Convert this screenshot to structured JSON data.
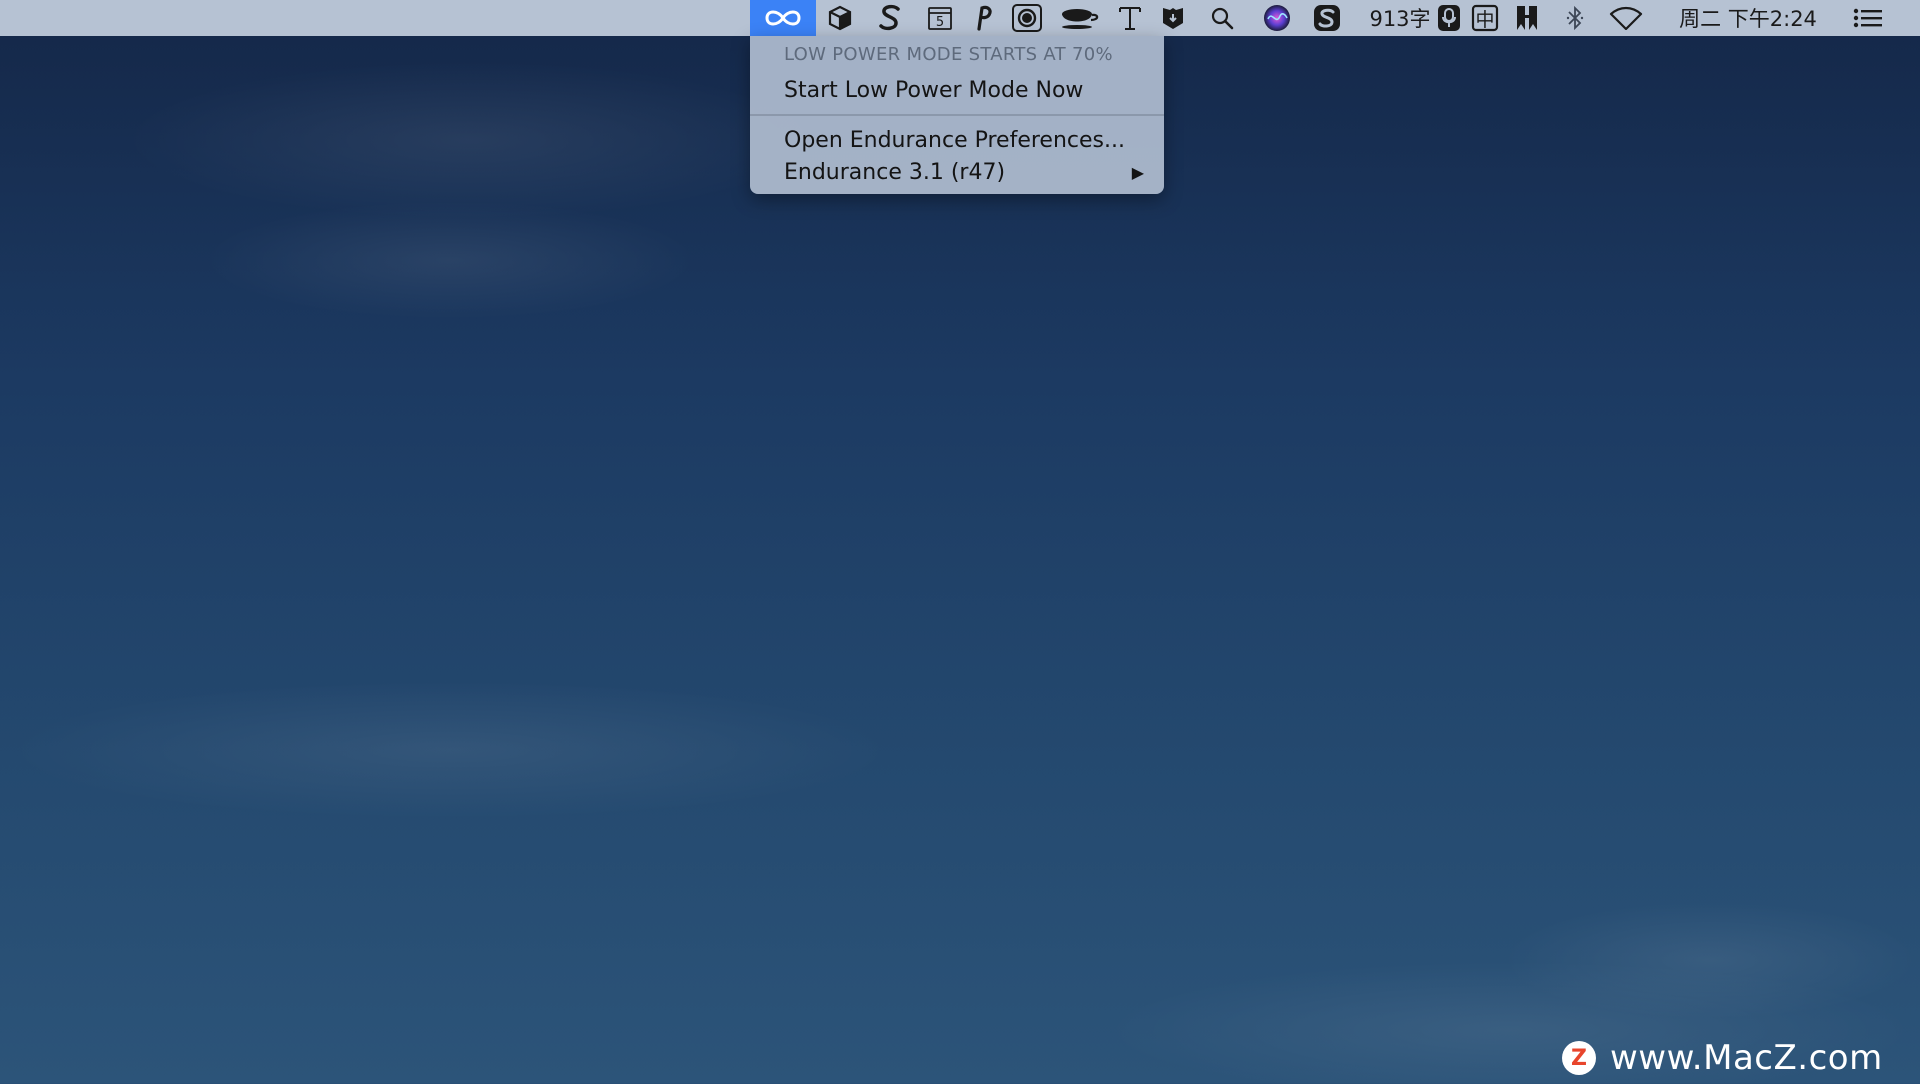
{
  "menubar": {
    "status_items": [
      {
        "name": "endurance-infinity-icon",
        "active": true
      },
      {
        "name": "cube-icon"
      },
      {
        "name": "s-script-icon"
      },
      {
        "name": "calendar-5-icon",
        "text": "5"
      },
      {
        "name": "p-icon"
      },
      {
        "name": "screenshot-icon"
      },
      {
        "name": "coffee-cup-icon"
      },
      {
        "name": "text-t-icon"
      },
      {
        "name": "shield-icon"
      },
      {
        "name": "search-icon"
      },
      {
        "name": "siri-icon"
      },
      {
        "name": "sogou-icon"
      },
      {
        "name": "microphone-icon"
      },
      {
        "name": "input-method-icon",
        "text": "中"
      },
      {
        "name": "bookmark-icon"
      },
      {
        "name": "bluetooth-icon"
      },
      {
        "name": "wifi-icon"
      },
      {
        "name": "notification-center-icon"
      }
    ],
    "word_count": "913字",
    "clock": "周二 下午2:24"
  },
  "menu": {
    "header": "LOW POWER MODE STARTS AT 70%",
    "items": [
      {
        "label": "Start Low Power Mode Now"
      },
      {
        "label": "Open Endurance Preferences..."
      },
      {
        "label": "Endurance 3.1 (r47)",
        "submenu": true
      }
    ],
    "submenu_arrow": "▶"
  },
  "watermark": {
    "logo_letter": "Z",
    "text": "www.MacZ.com"
  },
  "colors": {
    "menubar_bg": "#b6c2d3",
    "active_highlight": "#3b82f6",
    "watermark_logo": "#e8452c"
  }
}
